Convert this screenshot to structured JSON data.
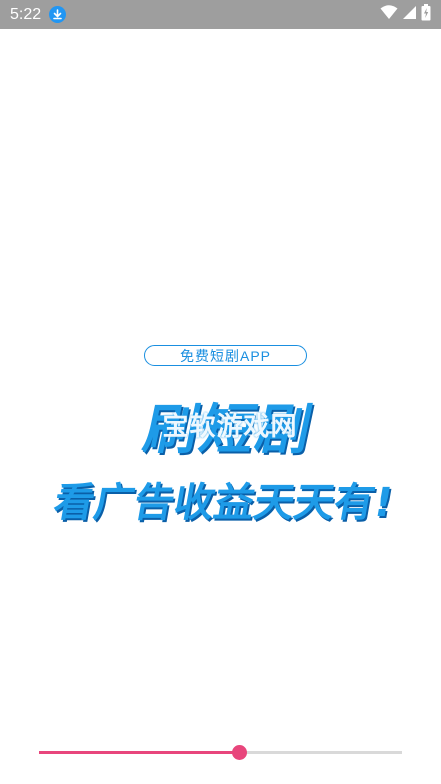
{
  "status_bar": {
    "time": "5:22",
    "icons": [
      "download-icon",
      "wifi-icon",
      "signal-icon",
      "battery-charging-icon"
    ]
  },
  "splash": {
    "slogan": "免费短剧APP",
    "title": "刷短剧",
    "watermark": "宝软游戏网",
    "tagline": "看广告收益天天有!"
  },
  "progress": {
    "value": 0.55
  },
  "colors": {
    "accent_blue": "#1e9be8",
    "progress_pink": "#e8467c",
    "status_gray": "#9e9e9e"
  }
}
